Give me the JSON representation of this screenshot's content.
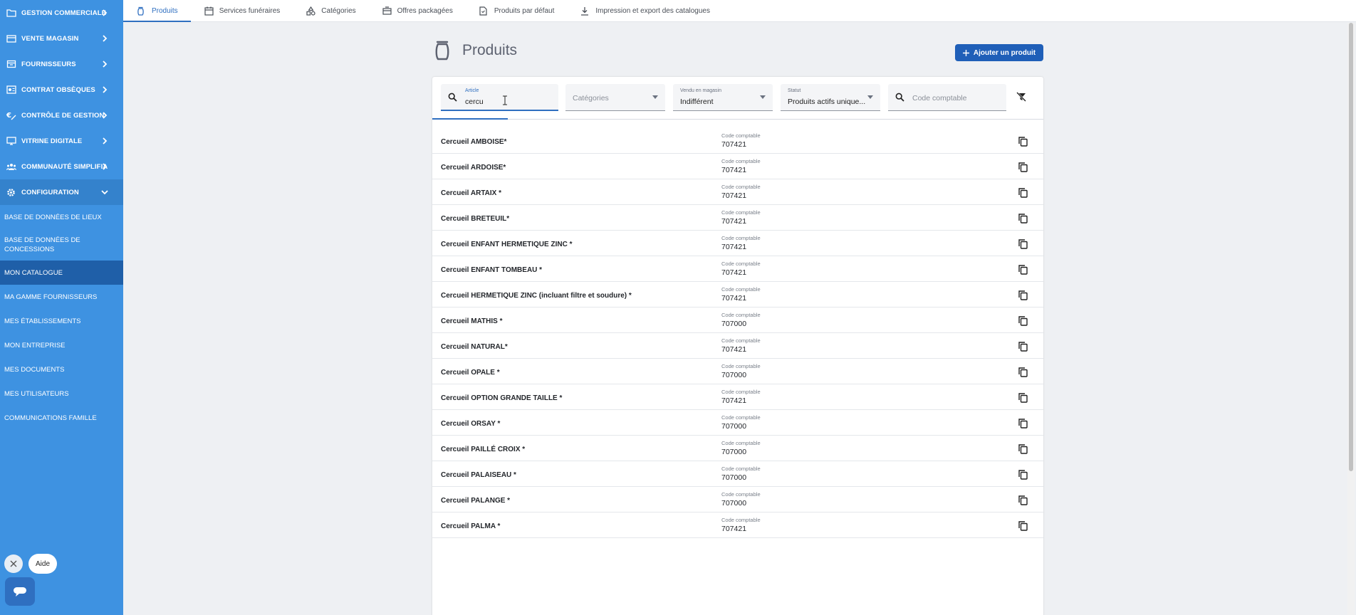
{
  "sidebar": {
    "items": [
      {
        "label": "GESTION COMMERCIALE",
        "icon": "folder-icon"
      },
      {
        "label": "VENTE MAGASIN",
        "icon": "store-icon"
      },
      {
        "label": "FOURNISSEURS",
        "icon": "box-icon"
      },
      {
        "label": "CONTRAT OBSÈQUES",
        "icon": "contract-icon"
      },
      {
        "label": "CONTRÔLE DE GESTION",
        "icon": "euro-icon"
      },
      {
        "label": "VITRINE DIGITALE",
        "icon": "monitor-icon"
      },
      {
        "label": "COMMUNAUTÉ SIMPLIFIA",
        "icon": "community-icon"
      },
      {
        "label": "CONFIGURATION",
        "icon": "gear-icon"
      }
    ],
    "subitems": [
      {
        "label": "BASE DE DONNÉES DE LIEUX"
      },
      {
        "label": "BASE DE DONNÉES DE CONCESSIONS"
      },
      {
        "label": "MON CATALOGUE"
      },
      {
        "label": "MA GAMME FOURNISSEURS"
      },
      {
        "label": "MES ÉTABLISSEMENTS"
      },
      {
        "label": "MON ENTREPRISE"
      },
      {
        "label": "MES DOCUMENTS"
      },
      {
        "label": "MES UTILISATEURS"
      },
      {
        "label": "COMMUNICATIONS FAMILLE"
      }
    ],
    "help_label": "Aide"
  },
  "tabs": [
    {
      "label": "Produits",
      "icon": "urn-icon"
    },
    {
      "label": "Services funéraires",
      "icon": "calendar-icon"
    },
    {
      "label": "Catégories",
      "icon": "shapes-icon"
    },
    {
      "label": "Offres packagées",
      "icon": "package-icon"
    },
    {
      "label": "Produits par défaut",
      "icon": "document-icon"
    },
    {
      "label": "Impression et export des catalogues",
      "icon": "download-icon"
    }
  ],
  "page": {
    "title": "Produits",
    "add_button": "Ajouter un produit"
  },
  "filters": {
    "article": {
      "label": "Article",
      "value": "cercu"
    },
    "categories": {
      "placeholder": "Catégories"
    },
    "vendu": {
      "label": "Vendu en magasin",
      "value": "Indifférent"
    },
    "statut": {
      "label": "Statut",
      "value": "Produits actifs unique..."
    },
    "code": {
      "placeholder": "Code comptable"
    }
  },
  "code_label": "Code comptable",
  "products": [
    {
      "name": "Cercueil AMBOISE*",
      "code": "707421"
    },
    {
      "name": "Cercueil ARDOISE*",
      "code": "707421"
    },
    {
      "name": "Cercueil ARTAIX *",
      "code": "707421"
    },
    {
      "name": "Cercueil BRETEUIL*",
      "code": "707421"
    },
    {
      "name": "Cercueil ENFANT HERMETIQUE ZINC *",
      "code": "707421"
    },
    {
      "name": "Cercueil ENFANT TOMBEAU *",
      "code": "707421"
    },
    {
      "name": "Cercueil HERMETIQUE ZINC (incluant filtre et soudure) *",
      "code": "707421"
    },
    {
      "name": "Cercueil MATHIS *",
      "code": "707000"
    },
    {
      "name": "Cercueil NATURAL*",
      "code": "707421"
    },
    {
      "name": "Cercueil OPALE *",
      "code": "707000"
    },
    {
      "name": "Cercueil OPTION GRANDE TAILLE *",
      "code": "707421"
    },
    {
      "name": "Cercueil ORSAY *",
      "code": "707000"
    },
    {
      "name": "Cercueil PAILLÉ CROIX *",
      "code": "707000"
    },
    {
      "name": "Cercueil PALAISEAU *",
      "code": "707000"
    },
    {
      "name": "Cercueil PALANGE *",
      "code": "707000"
    },
    {
      "name": "Cercueil PALMA *",
      "code": "707421"
    }
  ]
}
